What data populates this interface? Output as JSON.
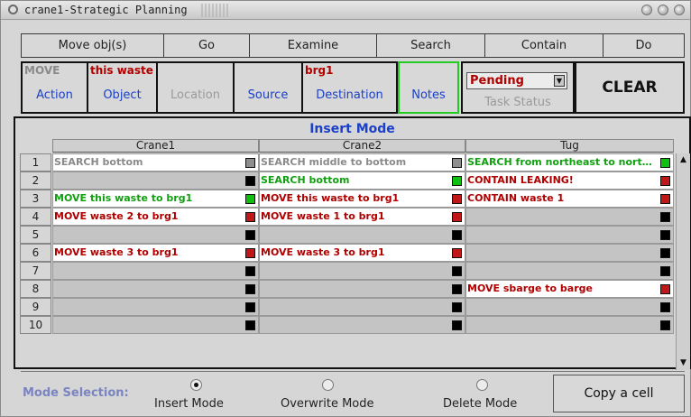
{
  "window": {
    "title": "crane1-Strategic Planning"
  },
  "menu": [
    "Move obj(s)",
    "Go",
    "Examine",
    "Search",
    "Contain",
    "Do"
  ],
  "command": {
    "action": {
      "value": "MOVE",
      "label": "Action"
    },
    "object": {
      "value": "this waste",
      "label": "Object"
    },
    "location": {
      "value": "",
      "label": "Location"
    },
    "source": {
      "value": "",
      "label": "Source"
    },
    "destination": {
      "value": "brg1",
      "label": "Destination"
    },
    "notes": {
      "value": "",
      "label": "Notes"
    },
    "task_status": {
      "value": "Pending",
      "label": "Task Status"
    },
    "clear_label": "CLEAR"
  },
  "grid": {
    "mode_title": "Insert Mode",
    "columns": [
      "Crane1",
      "Crane2",
      "Tug"
    ],
    "rows": [
      {
        "num": "1",
        "cells": [
          {
            "text": "SEARCH bottom",
            "tone": "gray",
            "status": "gray",
            "bg": "white"
          },
          {
            "text": "SEARCH middle to bottom",
            "tone": "gray",
            "status": "gray",
            "bg": "white"
          },
          {
            "text": "SEARCH from northeast to northw...",
            "tone": "green",
            "status": "green",
            "bg": "white"
          }
        ]
      },
      {
        "num": "2",
        "cells": [
          {
            "text": "",
            "tone": "red",
            "status": "black",
            "bg": "gray"
          },
          {
            "text": "SEARCH bottom",
            "tone": "green",
            "status": "green",
            "bg": "white"
          },
          {
            "text": "CONTAIN LEAKING!",
            "tone": "red",
            "status": "red",
            "bg": "white"
          }
        ]
      },
      {
        "num": "3",
        "cells": [
          {
            "text": "MOVE this waste to brg1",
            "tone": "green",
            "status": "green",
            "bg": "white"
          },
          {
            "text": "MOVE this waste to brg1",
            "tone": "red",
            "status": "red",
            "bg": "white"
          },
          {
            "text": "CONTAIN waste 1",
            "tone": "red",
            "status": "red",
            "bg": "white"
          }
        ]
      },
      {
        "num": "4",
        "cells": [
          {
            "text": "MOVE waste 2 to brg1",
            "tone": "red",
            "status": "red",
            "bg": "white"
          },
          {
            "text": "MOVE waste 1 to brg1",
            "tone": "red",
            "status": "red",
            "bg": "white"
          },
          {
            "text": "",
            "tone": "red",
            "status": "black",
            "bg": "gray"
          }
        ]
      },
      {
        "num": "5",
        "cells": [
          {
            "text": "",
            "tone": "red",
            "status": "black",
            "bg": "gray"
          },
          {
            "text": "",
            "tone": "red",
            "status": "black",
            "bg": "gray"
          },
          {
            "text": "",
            "tone": "red",
            "status": "black",
            "bg": "gray"
          }
        ]
      },
      {
        "num": "6",
        "cells": [
          {
            "text": "MOVE waste 3 to brg1",
            "tone": "red",
            "status": "red",
            "bg": "white"
          },
          {
            "text": "MOVE waste 3 to brg1",
            "tone": "red",
            "status": "red",
            "bg": "white"
          },
          {
            "text": "",
            "tone": "red",
            "status": "black",
            "bg": "gray"
          }
        ]
      },
      {
        "num": "7",
        "cells": [
          {
            "text": "",
            "tone": "red",
            "status": "black",
            "bg": "gray"
          },
          {
            "text": "",
            "tone": "red",
            "status": "black",
            "bg": "gray"
          },
          {
            "text": "",
            "tone": "red",
            "status": "black",
            "bg": "gray"
          }
        ]
      },
      {
        "num": "8",
        "cells": [
          {
            "text": "",
            "tone": "red",
            "status": "black",
            "bg": "gray"
          },
          {
            "text": "",
            "tone": "red",
            "status": "black",
            "bg": "gray"
          },
          {
            "text": "MOVE sbarge to barge",
            "tone": "red",
            "status": "red",
            "bg": "white"
          }
        ]
      },
      {
        "num": "9",
        "cells": [
          {
            "text": "",
            "tone": "red",
            "status": "black",
            "bg": "gray"
          },
          {
            "text": "",
            "tone": "red",
            "status": "black",
            "bg": "gray"
          },
          {
            "text": "",
            "tone": "red",
            "status": "black",
            "bg": "gray"
          }
        ]
      },
      {
        "num": "10",
        "cells": [
          {
            "text": "",
            "tone": "red",
            "status": "black",
            "bg": "gray"
          },
          {
            "text": "",
            "tone": "red",
            "status": "black",
            "bg": "gray"
          },
          {
            "text": "",
            "tone": "red",
            "status": "black",
            "bg": "gray"
          }
        ]
      }
    ]
  },
  "mode_selection": {
    "label": "Mode Selection:",
    "options": [
      {
        "label": "Insert Mode",
        "selected": true
      },
      {
        "label": "Overwrite Mode",
        "selected": false
      },
      {
        "label": "Delete Mode",
        "selected": false
      }
    ],
    "copy_label": "Copy a cell"
  },
  "colors": {
    "status_green": "#10c010",
    "status_red": "#c01818",
    "status_gray": "#8e8e8e",
    "status_black": "#000000",
    "label_blue": "#1a3fc8",
    "text_red": "#b00000",
    "text_green": "#10a010"
  }
}
